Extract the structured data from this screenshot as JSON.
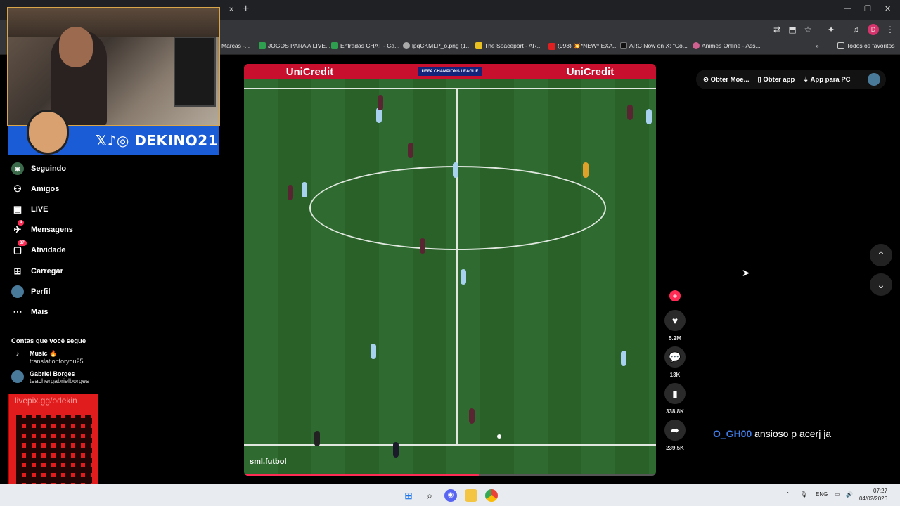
{
  "browser": {
    "tab_close": "×",
    "new_tab": "+",
    "window_controls": [
      "—",
      "❐",
      "✕"
    ],
    "bookmarks": [
      {
        "label": "Marcas -...",
        "color": "#888888"
      },
      {
        "label": "JOGOS PARA A LIVE...",
        "color": "#2e9e4f"
      },
      {
        "label": "Entradas CHAT - Ca...",
        "color": "#2e9e4f"
      },
      {
        "label": "lpqCKMLP_o.png (1...",
        "color": "#aaaaaa"
      },
      {
        "label": "The Spaceport - AR...",
        "color": "#e8c020"
      },
      {
        "label": "(993) 💥*NEW* EXA...",
        "color": "#e02020"
      },
      {
        "label": "ARC Now on X: \"Co...",
        "color": "#111111"
      },
      {
        "label": "Animes Online - Ass...",
        "color": "#d06090"
      }
    ],
    "bookmarks_more": "»",
    "all_favorites": "Todos os favoritos"
  },
  "stream": {
    "handle": "DEKINO21",
    "social_icons": "𝕏♪◎",
    "donation_url": "livepix.gg/odekin"
  },
  "sidebar": {
    "items": [
      {
        "label": "Seguindo",
        "icon": "following-icon",
        "glyph": "◉"
      },
      {
        "label": "Amigos",
        "icon": "friends-icon",
        "glyph": "👥"
      },
      {
        "label": "LIVE",
        "icon": "live-icon",
        "glyph": "▣"
      },
      {
        "label": "Mensagens",
        "icon": "messages-icon",
        "glyph": "✈",
        "badge": "4"
      },
      {
        "label": "Atividade",
        "icon": "activity-icon",
        "glyph": "▢",
        "badge": "37"
      },
      {
        "label": "Carregar",
        "icon": "upload-icon",
        "glyph": "⊞"
      },
      {
        "label": "Perfil",
        "icon": "profile-icon",
        "glyph": "●"
      },
      {
        "label": "Mais",
        "icon": "more-icon",
        "glyph": "⋯"
      }
    ],
    "following_title": "Contas que você segue",
    "following": [
      {
        "name": "Music 🔥",
        "handle": "translationforyou25"
      },
      {
        "name": "Gabriel Borges",
        "handle": "teachergabrielborges"
      }
    ]
  },
  "video": {
    "ad_text": "UniCredit",
    "competition": "UEFA CHAMPIONS LEAGUE",
    "source": "sml.futbol",
    "progress": 0.57
  },
  "actions": {
    "follow_plus": "+",
    "likes": "5.2M",
    "comments": "13K",
    "saves": "338.8K",
    "shares": "239.5K"
  },
  "top_bar": {
    "coins": "Obter Moe...",
    "app": "Obter app",
    "pc_app": "App para PC"
  },
  "nav": {
    "up": "⌃",
    "down": "⌄"
  },
  "chat": {
    "user": "O_GH00",
    "message": "ansioso p acerj ja"
  },
  "taskbar": {
    "lang": "ENG",
    "time": "07:27",
    "date": "04/02/2026"
  }
}
